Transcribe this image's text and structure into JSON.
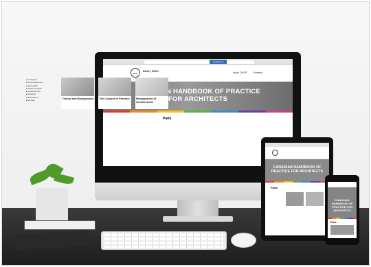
{
  "site": {
    "url": "",
    "contact_button": "Contact Us",
    "logo_text": "RAIC | IRAC",
    "nav": [
      "About CHOP",
      "Contents"
    ],
    "hero_line1": "CANADIAN HANDBOOK OF PRACTICE",
    "hero_line2": "FOR ARCHITECTS",
    "stripe_colors": [
      "#e03a2f",
      "#f28a1a",
      "#f6c317",
      "#5bb14a",
      "#2f8fd1",
      "#6a3fa0",
      "#d33b8c"
    ],
    "parts_title": "Parts",
    "toc": [
      "Introduction",
      "Acknowledgements",
      "Sponsorship",
      "Preface of CHOP",
      "Legal/Copyright",
      "Disclaimer",
      "Abbreviations",
      "Site Map"
    ],
    "cards": [
      {
        "label": "Theory and Background"
      },
      {
        "label": "The Context of Practice"
      },
      {
        "label": "Management of Architectural"
      }
    ]
  },
  "tablet": {
    "hero": "CANADIAN HANDBOOK OF PRACTICE FOR ARCHITECTS",
    "parts_title": "Parts"
  },
  "phone": {
    "hero": "CANADIAN HANDBOOK OF PRACTICE FOR ARCHITECTS",
    "parts_title": "Parts"
  }
}
